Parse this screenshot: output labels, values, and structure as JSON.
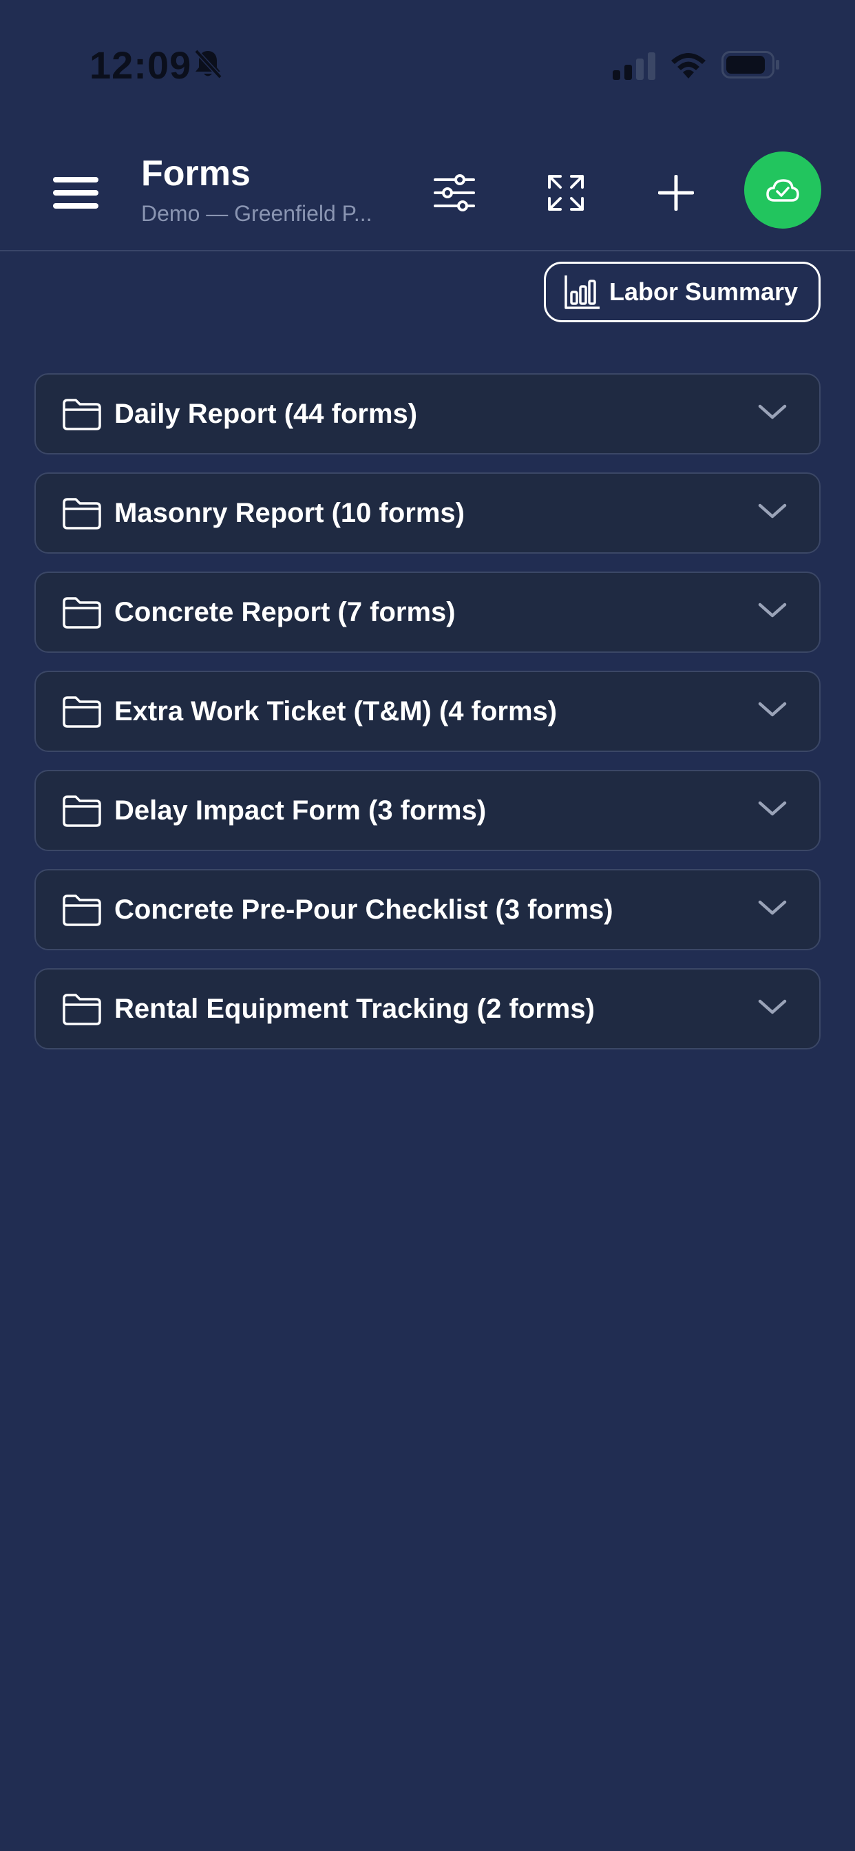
{
  "status_bar": {
    "time": "12:09"
  },
  "header": {
    "title": "Forms",
    "subtitle": "Demo — Greenfield P..."
  },
  "labor_summary": {
    "label": "Labor Summary"
  },
  "groups": [
    {
      "label": "Daily Report (44 forms)"
    },
    {
      "label": "Masonry Report (10 forms)"
    },
    {
      "label": "Concrete Report (7 forms)"
    },
    {
      "label": "Extra Work Ticket (T&M) (4 forms)"
    },
    {
      "label": "Delay Impact Form (3 forms)"
    },
    {
      "label": "Concrete Pre-Pour Checklist (3 forms)"
    },
    {
      "label": "Rental Equipment Tracking (2 forms)"
    }
  ],
  "colors": {
    "background": "#212d52",
    "card": "#1f2a42",
    "card_border": "#3b4766",
    "sync_green": "#22c55e",
    "subtitle": "#8a95b2",
    "chevron": "#9aa3b8"
  },
  "icons": {
    "menu": "hamburger-icon",
    "filter": "sliders-icon",
    "expand": "expand-arrows-icon",
    "add": "plus-icon",
    "sync": "cloud-check-icon",
    "labor": "bar-chart-icon",
    "group": "folder-icon",
    "group_toggle": "chevron-down-icon"
  }
}
